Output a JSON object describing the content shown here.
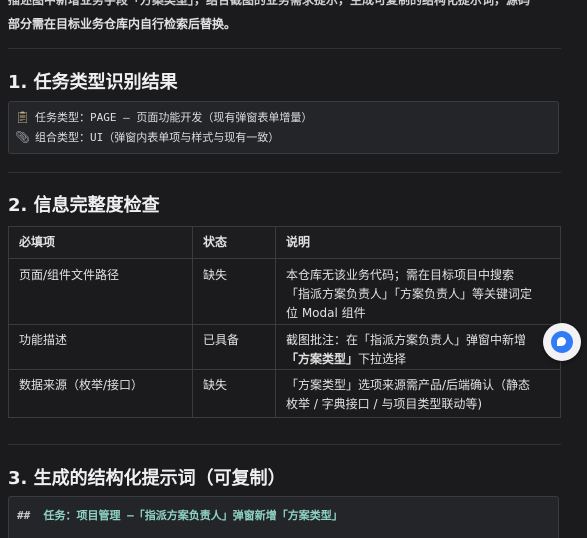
{
  "top": {
    "cut_line": "描述图中新增业务字段「方案类型」，结合截图的业务需求提示，生成可复制的结构化提示词，源码",
    "intro": "部分需在目标业务仓库内自行检索后替换。"
  },
  "section1": {
    "title": "1. 任务类型识别结果",
    "line1_label": "任务类型：PAGE — 页面功能开发（现有弹窗表单增量）",
    "line2_label": "组合类型：UI（弹窗内表单项与样式与现有一致）",
    "line1_icon": "clipboard-icon",
    "line2_icon": "paperclip-icon"
  },
  "section2": {
    "title": "2. 信息完整度检查",
    "headers": [
      "必填项",
      "状态",
      "说明"
    ],
    "rows": [
      {
        "item": "页面/组件文件路径",
        "status": "缺失",
        "desc_l1": "本仓库无该业务代码；需在目标项目中搜索",
        "desc_l2": "「指派方案负责人」「方案负责人」等关键词定",
        "desc_l3": "位 Modal 组件"
      },
      {
        "item": "功能描述",
        "status": "已具备",
        "desc_l1": "截图批注：在「指派方案负责人」弹窗中新增",
        "desc_l2_bold": "「方案类型」",
        "desc_l2_rest": "下拉选择"
      },
      {
        "item": "数据来源（枚举/接口）",
        "status": "缺失",
        "desc_l1": "「方案类型」选项来源需产品/后端确认（静态",
        "desc_l2": "枚举 / 字典接口 / 与项目类型联动等)"
      }
    ]
  },
  "section3": {
    "title": "3. 生成的结构化提示词（可复制）",
    "code_hash": "##",
    "code_text": "任务：项目管理 —「指派方案负责人」弹窗新增「方案类型」"
  },
  "colors": {
    "background": "#1b1b1d",
    "box": "#242528",
    "border": "#3a3b3f",
    "accent_button": "#2f7cf6",
    "code_text": "#8fd3c6"
  },
  "floating_button_icon": "assistant-chat-icon"
}
